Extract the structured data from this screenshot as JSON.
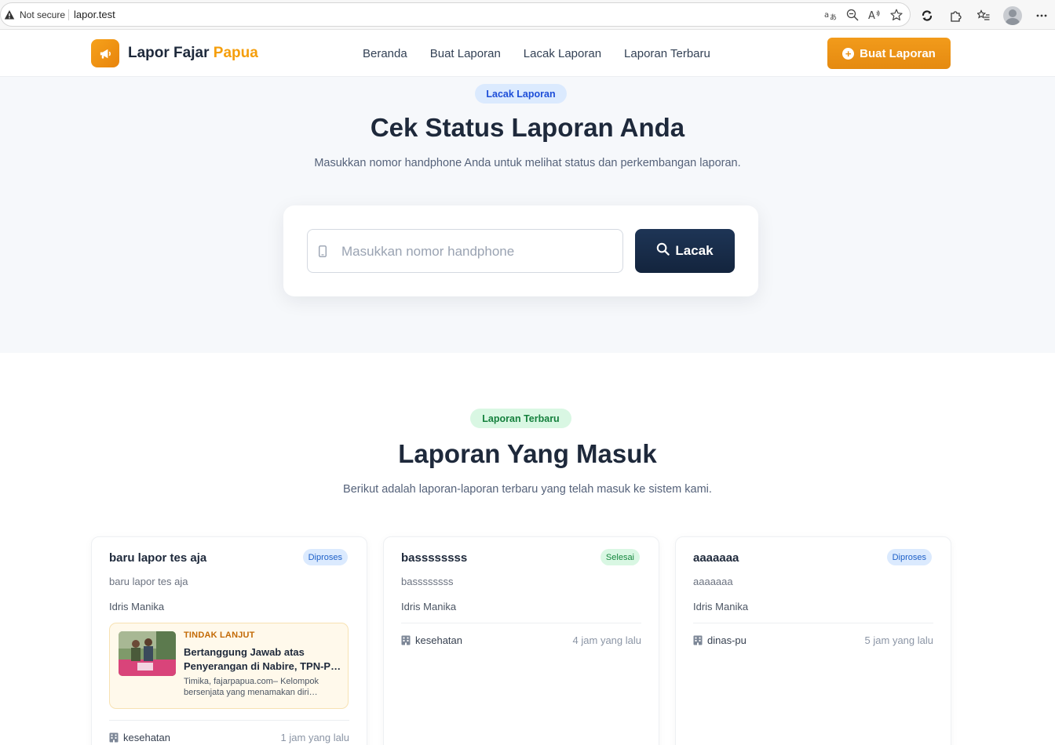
{
  "browser": {
    "security_label": "Not secure",
    "url": "lapor.test"
  },
  "brand": {
    "name_main": "Lapor Fajar",
    "name_accent": "Papua",
    "accent_color": "#f59e0b"
  },
  "nav": {
    "items": [
      "Beranda",
      "Buat Laporan",
      "Lacak Laporan",
      "Laporan Terbaru"
    ],
    "cta_label": "Buat Laporan"
  },
  "hero": {
    "pill": "Lacak Laporan",
    "title": "Cek Status Laporan Anda",
    "subtitle": "Masukkan nomor handphone Anda untuk melihat status dan perkembangan laporan.",
    "phone_placeholder": "Masukkan nomor handphone",
    "phone_value": "",
    "track_label": "Lacak"
  },
  "latest": {
    "pill": "Laporan Terbaru",
    "title": "Laporan Yang Masuk",
    "subtitle": "Berikut adalah laporan-laporan terbaru yang telah masuk ke sistem kami.",
    "reports": [
      {
        "title": "baru lapor tes aja",
        "status": "Diproses",
        "description": "baru lapor tes aja",
        "author": "Idris Manika",
        "category": "kesehatan",
        "time": "1 jam yang lalu",
        "followup": {
          "label": "TINDAK LANJUT",
          "title": "Bertanggung Jawab atas Penyerangan di Nabire, TPN-P…",
          "excerpt": "Timika, fajarpapua.com– Kelompok bersenjata yang menamakan diri…"
        }
      },
      {
        "title": "bassssssss",
        "status": "Selesai",
        "description": "bassssssss",
        "author": "Idris Manika",
        "category": "kesehatan",
        "time": "4 jam yang lalu"
      },
      {
        "title": "aaaaaaa",
        "status": "Diproses",
        "description": "aaaaaaa",
        "author": "Idris Manika",
        "category": "dinas-pu",
        "time": "5 jam yang lalu"
      }
    ]
  }
}
